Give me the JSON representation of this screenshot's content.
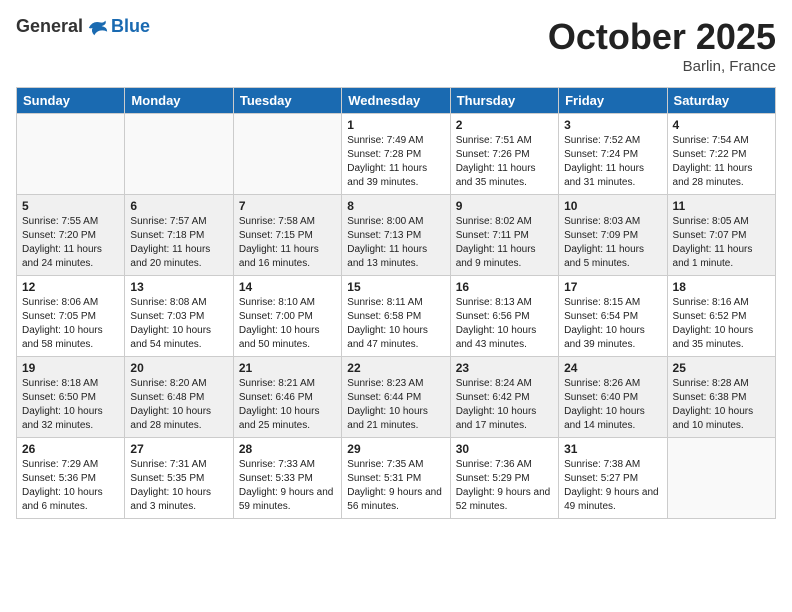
{
  "header": {
    "logo_general": "General",
    "logo_blue": "Blue",
    "month_title": "October 2025",
    "location": "Barlin, France"
  },
  "days_of_week": [
    "Sunday",
    "Monday",
    "Tuesday",
    "Wednesday",
    "Thursday",
    "Friday",
    "Saturday"
  ],
  "weeks": [
    [
      {
        "day": "",
        "info": ""
      },
      {
        "day": "",
        "info": ""
      },
      {
        "day": "",
        "info": ""
      },
      {
        "day": "1",
        "info": "Sunrise: 7:49 AM\nSunset: 7:28 PM\nDaylight: 11 hours and 39 minutes."
      },
      {
        "day": "2",
        "info": "Sunrise: 7:51 AM\nSunset: 7:26 PM\nDaylight: 11 hours and 35 minutes."
      },
      {
        "day": "3",
        "info": "Sunrise: 7:52 AM\nSunset: 7:24 PM\nDaylight: 11 hours and 31 minutes."
      },
      {
        "day": "4",
        "info": "Sunrise: 7:54 AM\nSunset: 7:22 PM\nDaylight: 11 hours and 28 minutes."
      }
    ],
    [
      {
        "day": "5",
        "info": "Sunrise: 7:55 AM\nSunset: 7:20 PM\nDaylight: 11 hours and 24 minutes."
      },
      {
        "day": "6",
        "info": "Sunrise: 7:57 AM\nSunset: 7:18 PM\nDaylight: 11 hours and 20 minutes."
      },
      {
        "day": "7",
        "info": "Sunrise: 7:58 AM\nSunset: 7:15 PM\nDaylight: 11 hours and 16 minutes."
      },
      {
        "day": "8",
        "info": "Sunrise: 8:00 AM\nSunset: 7:13 PM\nDaylight: 11 hours and 13 minutes."
      },
      {
        "day": "9",
        "info": "Sunrise: 8:02 AM\nSunset: 7:11 PM\nDaylight: 11 hours and 9 minutes."
      },
      {
        "day": "10",
        "info": "Sunrise: 8:03 AM\nSunset: 7:09 PM\nDaylight: 11 hours and 5 minutes."
      },
      {
        "day": "11",
        "info": "Sunrise: 8:05 AM\nSunset: 7:07 PM\nDaylight: 11 hours and 1 minute."
      }
    ],
    [
      {
        "day": "12",
        "info": "Sunrise: 8:06 AM\nSunset: 7:05 PM\nDaylight: 10 hours and 58 minutes."
      },
      {
        "day": "13",
        "info": "Sunrise: 8:08 AM\nSunset: 7:03 PM\nDaylight: 10 hours and 54 minutes."
      },
      {
        "day": "14",
        "info": "Sunrise: 8:10 AM\nSunset: 7:00 PM\nDaylight: 10 hours and 50 minutes."
      },
      {
        "day": "15",
        "info": "Sunrise: 8:11 AM\nSunset: 6:58 PM\nDaylight: 10 hours and 47 minutes."
      },
      {
        "day": "16",
        "info": "Sunrise: 8:13 AM\nSunset: 6:56 PM\nDaylight: 10 hours and 43 minutes."
      },
      {
        "day": "17",
        "info": "Sunrise: 8:15 AM\nSunset: 6:54 PM\nDaylight: 10 hours and 39 minutes."
      },
      {
        "day": "18",
        "info": "Sunrise: 8:16 AM\nSunset: 6:52 PM\nDaylight: 10 hours and 35 minutes."
      }
    ],
    [
      {
        "day": "19",
        "info": "Sunrise: 8:18 AM\nSunset: 6:50 PM\nDaylight: 10 hours and 32 minutes."
      },
      {
        "day": "20",
        "info": "Sunrise: 8:20 AM\nSunset: 6:48 PM\nDaylight: 10 hours and 28 minutes."
      },
      {
        "day": "21",
        "info": "Sunrise: 8:21 AM\nSunset: 6:46 PM\nDaylight: 10 hours and 25 minutes."
      },
      {
        "day": "22",
        "info": "Sunrise: 8:23 AM\nSunset: 6:44 PM\nDaylight: 10 hours and 21 minutes."
      },
      {
        "day": "23",
        "info": "Sunrise: 8:24 AM\nSunset: 6:42 PM\nDaylight: 10 hours and 17 minutes."
      },
      {
        "day": "24",
        "info": "Sunrise: 8:26 AM\nSunset: 6:40 PM\nDaylight: 10 hours and 14 minutes."
      },
      {
        "day": "25",
        "info": "Sunrise: 8:28 AM\nSunset: 6:38 PM\nDaylight: 10 hours and 10 minutes."
      }
    ],
    [
      {
        "day": "26",
        "info": "Sunrise: 7:29 AM\nSunset: 5:36 PM\nDaylight: 10 hours and 6 minutes."
      },
      {
        "day": "27",
        "info": "Sunrise: 7:31 AM\nSunset: 5:35 PM\nDaylight: 10 hours and 3 minutes."
      },
      {
        "day": "28",
        "info": "Sunrise: 7:33 AM\nSunset: 5:33 PM\nDaylight: 9 hours and 59 minutes."
      },
      {
        "day": "29",
        "info": "Sunrise: 7:35 AM\nSunset: 5:31 PM\nDaylight: 9 hours and 56 minutes."
      },
      {
        "day": "30",
        "info": "Sunrise: 7:36 AM\nSunset: 5:29 PM\nDaylight: 9 hours and 52 minutes."
      },
      {
        "day": "31",
        "info": "Sunrise: 7:38 AM\nSunset: 5:27 PM\nDaylight: 9 hours and 49 minutes."
      },
      {
        "day": "",
        "info": ""
      }
    ]
  ]
}
